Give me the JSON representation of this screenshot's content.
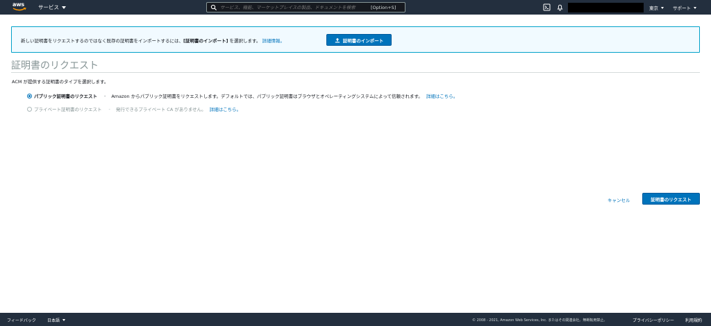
{
  "topnav": {
    "logo_text": "aws",
    "services_label": "サービス",
    "search_placeholder": "サービス、機能、マーケットプレイスの製品、ドキュメントを検索",
    "search_shortcut": "[Option+S]",
    "region_label": "東京",
    "support_label": "サポート"
  },
  "banner": {
    "text_before": "新しい証明書をリクエストするのではなく既存の証明書をインポートするには、",
    "text_bold": "[証明書のインポート]",
    "text_after": " を選択します。",
    "link_label": "詳細情報。",
    "import_button_label": "証明書のインポート"
  },
  "main": {
    "title": "証明書のリクエスト",
    "subtitle": "ACM が提供する証明書のタイプを選択します。",
    "options": [
      {
        "label": "パブリック証明書のリクエスト",
        "separator": "-",
        "description": "Amazon からパブリック証明書をリクエストします。デフォルトでは、パブリック証明書はブラウザとオペレーティングシステムによって信頼されます。",
        "link": "詳細はこちら。",
        "selected": true,
        "disabled": false
      },
      {
        "label": "プライベート証明書のリクエスト",
        "separator": "-",
        "description": "発行できるプライベート CA がありません。",
        "link": "詳細はこちら。",
        "selected": false,
        "disabled": true
      }
    ],
    "cancel_label": "キャンセル",
    "request_button_label": "証明書のリクエスト"
  },
  "footer": {
    "feedback_label": "フィードバック",
    "language_label": "日本語",
    "copyright": "© 2008 - 2021, Amazon Web Services, Inc. またはその関連会社。無断転用禁止。",
    "privacy_label": "プライバシーポリシー",
    "terms_label": "利用規約"
  },
  "colors": {
    "nav_bg": "#232f3e",
    "primary": "#0073bb",
    "banner_bg": "#f1faff",
    "banner_border": "#00a1c9",
    "aws_orange": "#ff9900"
  }
}
